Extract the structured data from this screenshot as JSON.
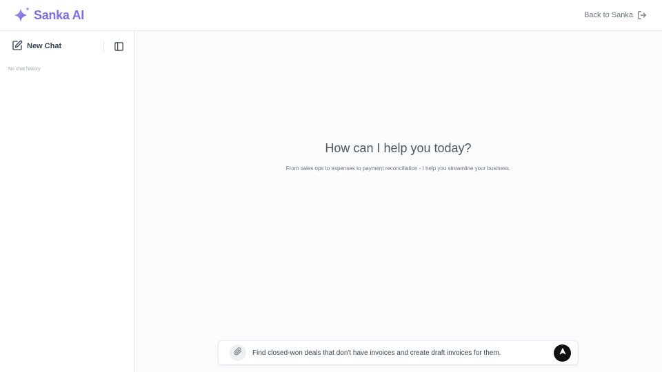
{
  "header": {
    "brand": "Sanka AI",
    "back_label": "Back to Sanka"
  },
  "sidebar": {
    "new_chat_label": "New Chat",
    "empty_history": "No chat history"
  },
  "main": {
    "title": "How can I help you today?",
    "subtitle": "From sales ops to expenses to payment reconciliation - I help you streamline your business."
  },
  "composer": {
    "value": "Find closed-won deals that don't have invoices and create draft invoices for them."
  },
  "icons": {
    "logo": "sparkle-icon",
    "back": "logout-icon",
    "new_chat": "edit-icon",
    "sidebar_toggle": "sidebar-toggle-icon",
    "attach": "paperclip-icon",
    "send": "arrow-up-icon"
  },
  "colors": {
    "brand": "#7c6fe0",
    "send_button": "#111111"
  }
}
